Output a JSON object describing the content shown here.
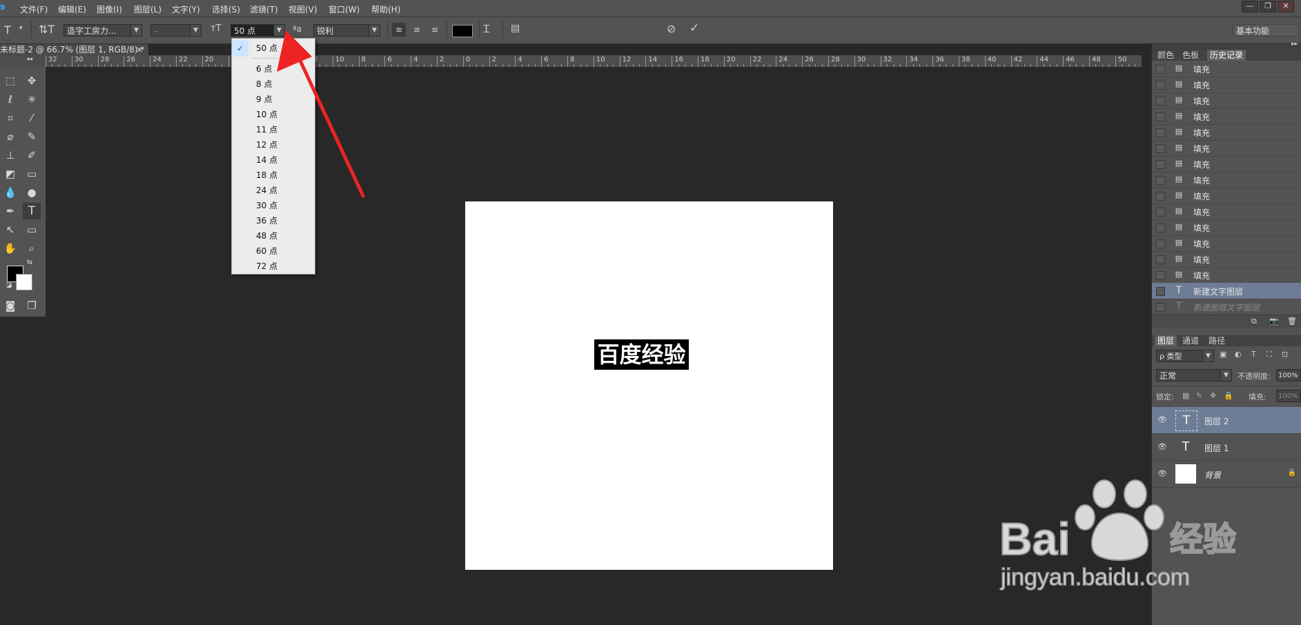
{
  "app": {
    "logo": "s"
  },
  "menu": [
    "文件(F)",
    "编辑(E)",
    "图像(I)",
    "图层(L)",
    "文字(Y)",
    "选择(S)",
    "滤镜(T)",
    "视图(V)",
    "窗口(W)",
    "帮助(H)"
  ],
  "window_controls": {
    "minimize": "—",
    "restore": "❐",
    "close": "✕"
  },
  "options": {
    "font_family": "造字工房力...",
    "font_style": "-",
    "font_size": "50 点",
    "aa_label": "ªa",
    "antialias": "锐利",
    "workspace": "基本功能",
    "text_color": "#000000"
  },
  "document": {
    "tab_title": "未标题-2 @ 66.7% (图层 1, RGB/8) *",
    "tab_close": "×",
    "text_content": "百度经验"
  },
  "ruler": {
    "ticks": [
      "32",
      "30",
      "28",
      "26",
      "24",
      "22",
      "20",
      "18",
      "16",
      "14",
      "12",
      "10",
      "8",
      "6",
      "4",
      "2",
      "0",
      "2",
      "4",
      "6",
      "8",
      "10",
      "12",
      "14",
      "16",
      "18",
      "20",
      "22",
      "24",
      "26",
      "28",
      "30",
      "32",
      "34",
      "36",
      "38",
      "40",
      "42",
      "44",
      "46",
      "48",
      "50"
    ]
  },
  "font_size_dropdown": {
    "selected": "50 点",
    "options": [
      "6 点",
      "8 点",
      "9 点",
      "10 点",
      "11 点",
      "12 点",
      "14 点",
      "18 点",
      "24 点",
      "30 点",
      "36 点",
      "48 点",
      "60 点",
      "72 点"
    ]
  },
  "history_panel": {
    "tabs": [
      "颜色",
      "色板",
      "历史记录"
    ],
    "active_tab": "历史记录",
    "items": [
      "填充",
      "填充",
      "填充",
      "填充",
      "填充",
      "填充",
      "填充",
      "填充",
      "填充",
      "填充",
      "填充",
      "填充",
      "填充",
      "填充",
      "新建文字图层",
      "新建图框文字图层"
    ],
    "selected_index": 14
  },
  "layers_panel": {
    "tabs": [
      "图层",
      "通道",
      "路径"
    ],
    "filter_kind": "ρ 类型",
    "blend_mode": "正常",
    "opacity_label": "不透明度:",
    "opacity_value": "100%",
    "lock_label": "锁定:",
    "fill_label": "填充:",
    "fill_value": "100%",
    "layers": [
      {
        "name": "图层 2",
        "type": "text",
        "selected": true
      },
      {
        "name": "图层 1",
        "type": "text",
        "selected": false
      },
      {
        "name": "背景",
        "type": "background",
        "selected": false
      }
    ]
  },
  "watermark": {
    "brand": "Bai",
    "brand_suffix": "经验",
    "url": "jingyan.baidu.com"
  },
  "annotation": {
    "arrow_color": "#ee2424"
  }
}
